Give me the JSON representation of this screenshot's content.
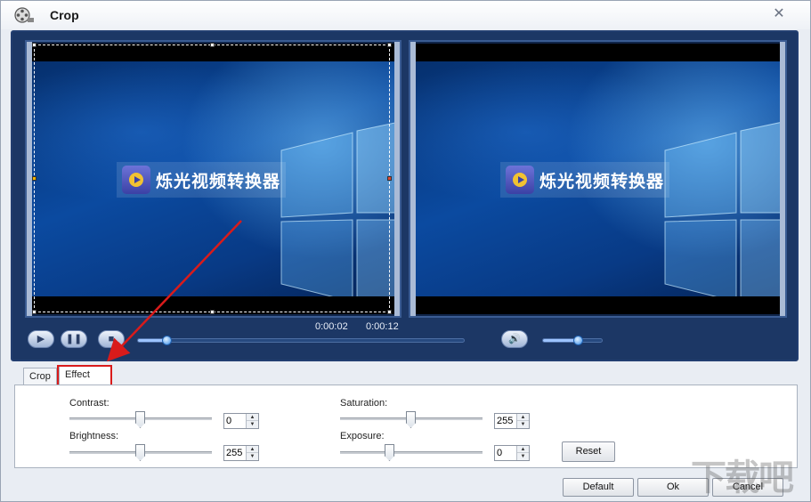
{
  "window": {
    "title": "Crop"
  },
  "video": {
    "logo_text": "烁光视频转换器"
  },
  "playback": {
    "current_time": "0:00:02",
    "total_time": "0:00:12",
    "progress_fraction": 0.09,
    "volume_fraction": 0.6
  },
  "tabs": [
    {
      "label": "Crop",
      "selected": false
    },
    {
      "label": "Effect",
      "selected": true
    }
  ],
  "effect": {
    "contrast": {
      "label": "Contrast:",
      "value": "0",
      "slider_fraction": 0.5
    },
    "brightness": {
      "label": "Brightness:",
      "value": "255",
      "slider_fraction": 0.5
    },
    "saturation": {
      "label": "Saturation:",
      "value": "255",
      "slider_fraction": 0.5
    },
    "exposure": {
      "label": "Exposure:",
      "value": "0",
      "slider_fraction": 0.35
    },
    "reset_label": "Reset"
  },
  "footer": {
    "default_label": "Default",
    "ok_label": "Ok",
    "cancel_label": "Cancel"
  },
  "watermark_text": "下载吧",
  "colors": {
    "annotation_red": "#d91b1b",
    "player_bg": "#1c3765"
  }
}
